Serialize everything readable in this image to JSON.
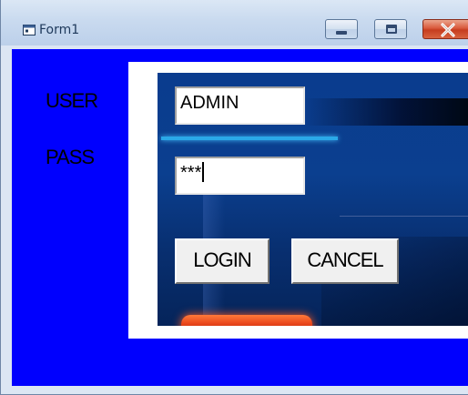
{
  "window": {
    "title": "Form1",
    "app_icon": "form-icon",
    "controls": [
      "minimize-icon",
      "maximize-icon",
      "close-icon"
    ]
  },
  "form": {
    "user_label": "USER",
    "pass_label": "PASS",
    "user_value": "ADMIN",
    "pass_value": "***",
    "login_label": "LOGIN",
    "cancel_label": "CANCEL"
  },
  "colors": {
    "form_background": "#0000FE",
    "button_face": "#F0F0F0",
    "close_button": "#C63D1F"
  }
}
